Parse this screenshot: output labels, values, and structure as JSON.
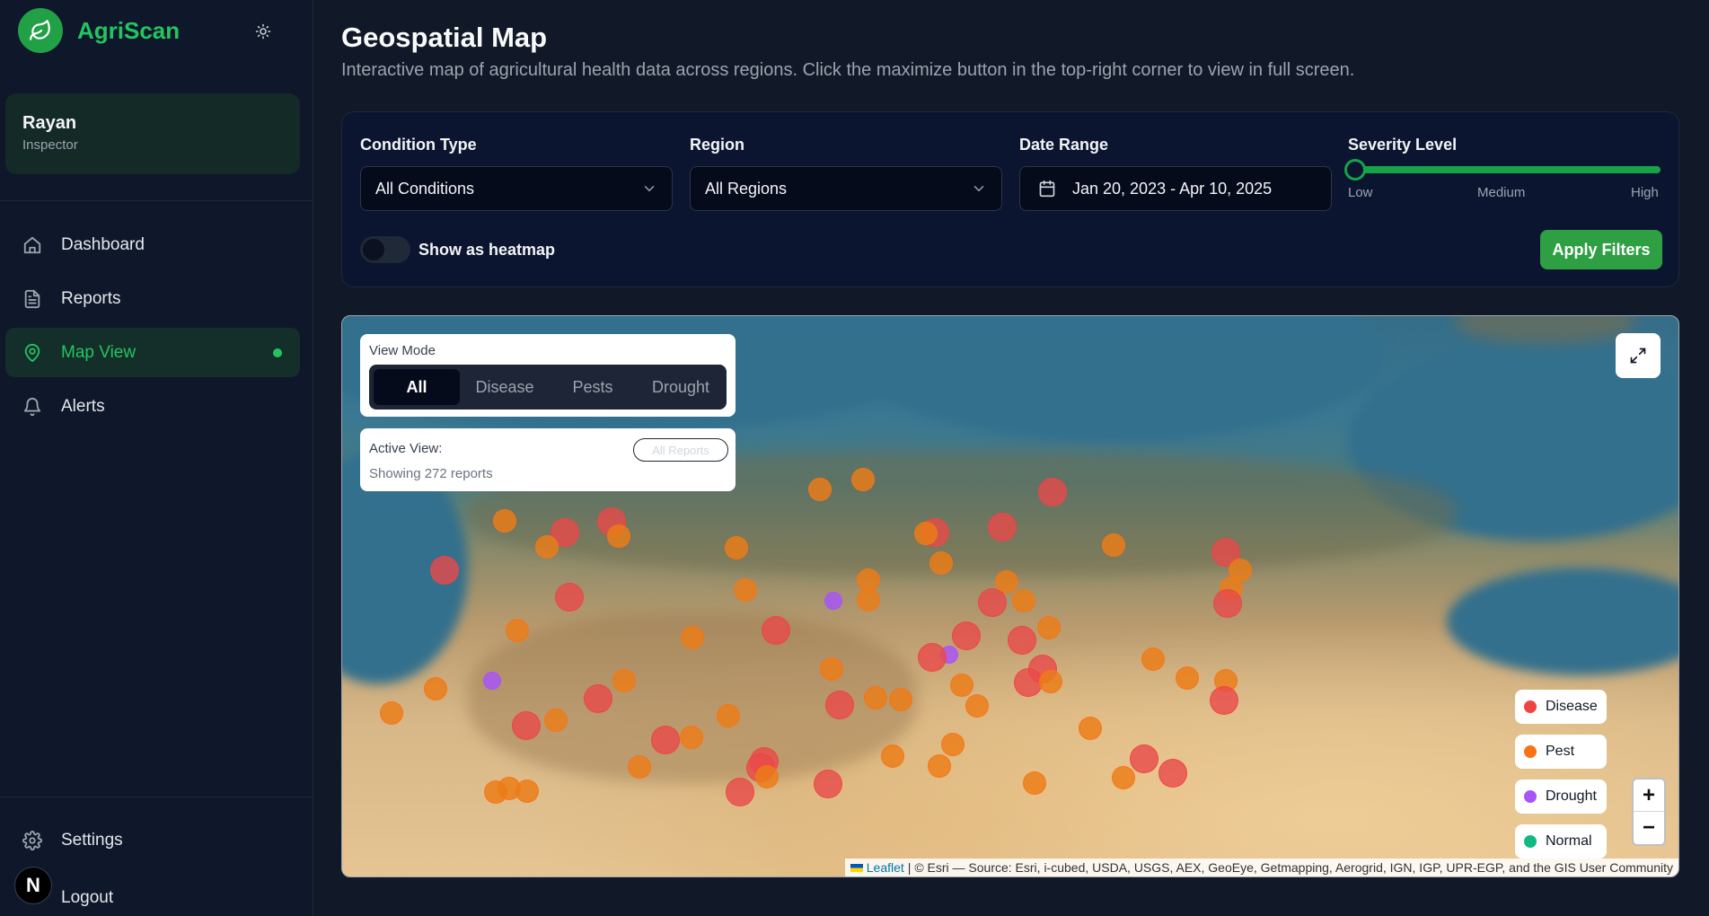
{
  "app": {
    "name": "AgriScan"
  },
  "user": {
    "name": "Rayan",
    "role": "Inspector"
  },
  "nav": {
    "items": [
      {
        "label": "Dashboard"
      },
      {
        "label": "Reports"
      },
      {
        "label": "Map View"
      },
      {
        "label": "Alerts"
      }
    ],
    "footer": [
      {
        "label": "Settings"
      },
      {
        "label": "Logout"
      }
    ],
    "badge": "N"
  },
  "page": {
    "title": "Geospatial Map",
    "subtitle": "Interactive map of agricultural health data across regions. Click the maximize button in the top-right corner to view in full screen."
  },
  "filters": {
    "condition": {
      "label": "Condition Type",
      "value": "All Conditions"
    },
    "region": {
      "label": "Region",
      "value": "All Regions"
    },
    "date": {
      "label": "Date Range",
      "value": "Jan 20, 2023 - Apr 10, 2025"
    },
    "severity": {
      "label": "Severity Level",
      "low": "Low",
      "medium": "Medium",
      "high": "High",
      "value": 0
    },
    "heatmap": {
      "label": "Show as heatmap",
      "on": false
    },
    "apply": "Apply Filters"
  },
  "map": {
    "view_mode": {
      "label": "View Mode",
      "options": [
        "All",
        "Disease",
        "Pests",
        "Drought"
      ],
      "selected": "All"
    },
    "active_view": {
      "label": "Active View:",
      "chip": "All Reports",
      "summary": "Showing 272 reports"
    },
    "legend": [
      {
        "label": "Disease",
        "color": "#ef4444"
      },
      {
        "label": "Pest",
        "color": "#f97316"
      },
      {
        "label": "Drought",
        "color": "#a855f7"
      },
      {
        "label": "Normal",
        "color": "#10b981"
      }
    ],
    "zoom_in": "+",
    "zoom_out": "−",
    "attribution": {
      "link": "Leaflet",
      "text": "| © Esri — Source: Esri, i-cubed, USDA, USGS, AEX, GeoEye, Getmapping, Aerogrid, IGN, IGP, UPR-EGP, and the GIS User Community"
    }
  }
}
